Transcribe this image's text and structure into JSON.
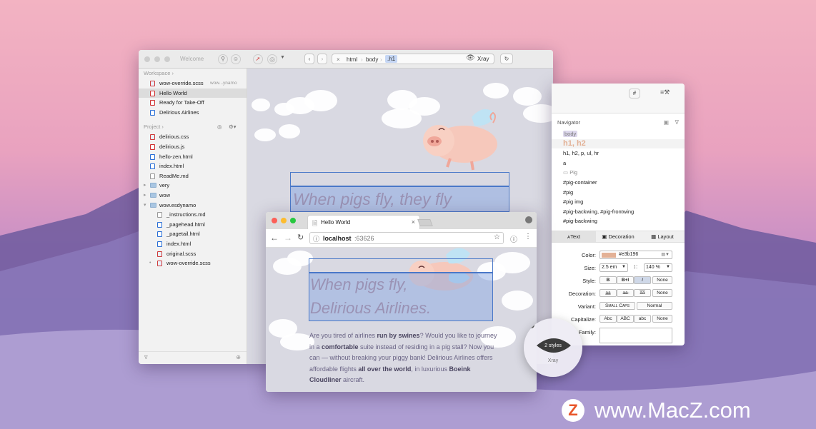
{
  "main_window": {
    "title": "Welcome",
    "breadcrumb": [
      "html",
      "body",
      ".h1"
    ],
    "xray_label": "Xray",
    "workspace_label": "Workspace",
    "workspace_items": [
      {
        "label": "wow-override.scss",
        "extra": "wow...ynamo",
        "icon": "css"
      },
      {
        "label": "Hello World",
        "extra": "",
        "icon": "js"
      },
      {
        "label": "Ready for Take-Off",
        "extra": "",
        "icon": "js"
      },
      {
        "label": "Delirious Airlines",
        "extra": "",
        "icon": "html"
      }
    ],
    "project_label": "Project",
    "project_items": [
      {
        "label": "delirious.css",
        "icon": "css",
        "indent": 0
      },
      {
        "label": "delirious.js",
        "icon": "js",
        "indent": 0
      },
      {
        "label": "hello-zen.html",
        "icon": "html",
        "indent": 0
      },
      {
        "label": "index.html",
        "icon": "html",
        "indent": 0
      },
      {
        "label": "ReadMe.md",
        "icon": "md",
        "indent": 0
      },
      {
        "label": "very",
        "icon": "folder",
        "indent": 0
      },
      {
        "label": "wow",
        "icon": "folder",
        "indent": 0
      },
      {
        "label": "wow.esdynamo",
        "icon": "folder",
        "indent": 0
      },
      {
        "label": "_instructions.md",
        "icon": "md",
        "indent": 1
      },
      {
        "label": "_pagehead.html",
        "icon": "html",
        "indent": 1
      },
      {
        "label": "_pagetail.html",
        "icon": "html",
        "indent": 1
      },
      {
        "label": "index.html",
        "icon": "html",
        "indent": 1
      },
      {
        "label": "original.scss",
        "icon": "css",
        "indent": 1
      },
      {
        "label": "wow-override.scss",
        "icon": "css",
        "indent": 1
      }
    ],
    "headline": "When pigs fly, they fly"
  },
  "inspector": {
    "navigator_label": "Navigator",
    "selectors": [
      "body",
      "h1, h2",
      "h1, h2, p, ul, hr",
      "a",
      "Pig",
      "#pig-container",
      "#pig",
      "#pig img",
      "#pig-backwing, #pig-frontwing",
      "#pig-backwing"
    ],
    "tabs": [
      "Text",
      "Decoration",
      "Layout"
    ],
    "color_label": "Color:",
    "color_value": "#e3b196",
    "color_swatch": "#e3b196",
    "size_label": "Size:",
    "size_value": "2.5 em",
    "line_height": "140 %",
    "style_label": "Style:",
    "style_opts": [
      "B",
      "B+I",
      "I",
      "None"
    ],
    "decoration_label": "Decoration:",
    "decoration_opts": [
      "a̲a̲",
      "a̶a̶",
      "a̿a̿",
      "None"
    ],
    "variant_label": "Variant:",
    "variant_opts": [
      "Small Caps",
      "Normal"
    ],
    "capitalize_label": "Capitalize:",
    "capitalize_opts": [
      "Abc",
      "ABC",
      "abc",
      "None"
    ],
    "family_label": "Family:"
  },
  "browser": {
    "tab_title": "Hello World",
    "url_host": "localhost",
    "url_port": ":63626",
    "headline_1": "When pigs fly,",
    "headline_2": "Delirious Airlines.",
    "p1": "Are you tired of airlines ",
    "p1b": "run by swines",
    "p2": "? Would you like to journey in a ",
    "p2b": "comfortable",
    "p3": " suite instead of residing in a pig stall? Now you can — without breaking your piggy bank! Delirious Airlines offers affordable flights ",
    "p3b": "all over the world",
    "p4": ", in luxurious ",
    "p4b": "Boeink Cloudliner",
    "p5": " aircraft."
  },
  "xray": {
    "count_label": "2 styles",
    "label": "Xray"
  },
  "watermark": {
    "logo_letter": "Z",
    "text": "www.MacZ.com"
  }
}
